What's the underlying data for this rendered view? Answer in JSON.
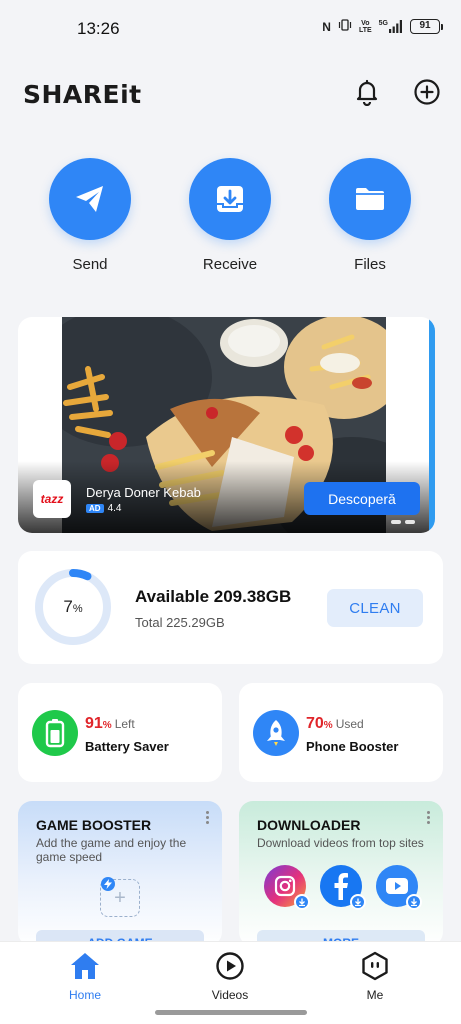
{
  "status_bar": {
    "time": "13:26",
    "nfc": "N",
    "volte_top": "Vo",
    "volte_bottom": "LTE",
    "network": "5G",
    "battery": "91"
  },
  "header": {
    "logo": "SHAREit",
    "icons": [
      "bell-icon",
      "plus-circle-icon"
    ]
  },
  "quick_actions": [
    {
      "label": "Send",
      "icon": "paper-plane-icon"
    },
    {
      "label": "Receive",
      "icon": "download-tray-icon"
    },
    {
      "label": "Files",
      "icon": "folder-icon"
    }
  ],
  "ad": {
    "brand_logo": "tazz",
    "title": "Derya Doner Kebab",
    "badge": "AD",
    "rating": "4.4",
    "cta": "Descoperă"
  },
  "storage": {
    "percent_value": "7",
    "percent_sign": "%",
    "used_fraction": 0.07,
    "available": "Available 209.38GB",
    "total": "Total 225.29GB",
    "clean_label": "CLEAN"
  },
  "battery_saver": {
    "value": "91",
    "unit": "%",
    "suffix": "Left",
    "name": "Battery Saver"
  },
  "phone_booster": {
    "value": "70",
    "unit": "%",
    "suffix": "Used",
    "name": "Phone Booster"
  },
  "game_booster": {
    "title": "GAME BOOSTER",
    "description": "Add the game and enjoy the game speed",
    "button": "ADD GAME"
  },
  "downloader": {
    "title": "DOWNLOADER",
    "description": "Download videos from top sites",
    "button": "MORE",
    "sites": [
      "instagram-icon",
      "facebook-icon",
      "youtube-icon"
    ]
  },
  "bottom_nav": [
    {
      "label": "Home",
      "icon": "home-icon",
      "active": true
    },
    {
      "label": "Videos",
      "icon": "play-circle-icon",
      "active": false
    },
    {
      "label": "Me",
      "icon": "profile-icon",
      "active": false
    }
  ],
  "colors": {
    "accent": "#2f86f6",
    "alert_red": "#e0252a",
    "battery_green": "#1fc94a"
  }
}
